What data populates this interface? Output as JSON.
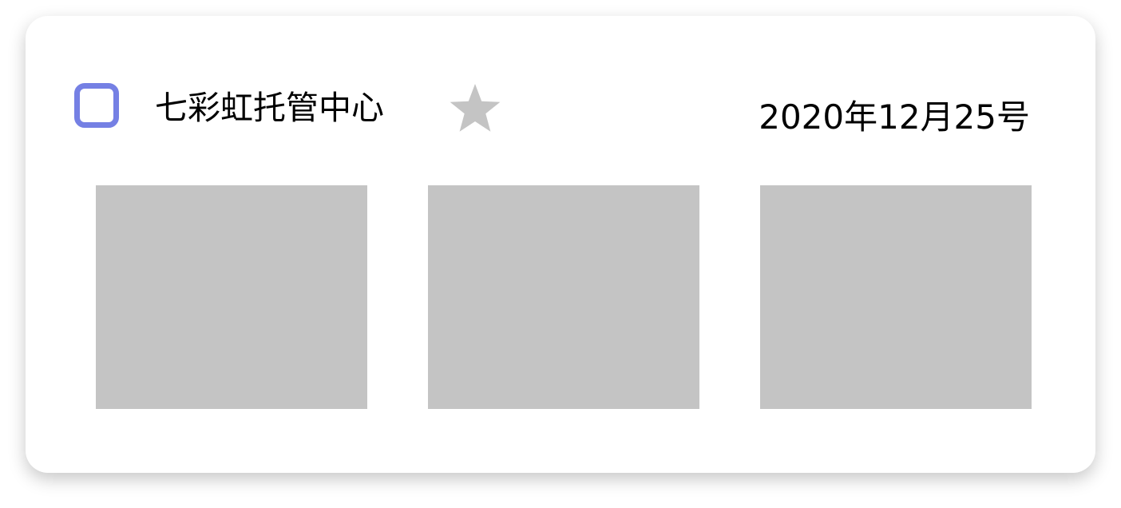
{
  "card": {
    "title": "七彩虹托管中心",
    "date": "2020年12月25号",
    "checkbox": {
      "checked": false
    },
    "favorite": {
      "icon": "star-icon",
      "starred": false
    },
    "images": [
      {
        "icon": "image-placeholder"
      },
      {
        "icon": "image-placeholder"
      },
      {
        "icon": "image-placeholder"
      }
    ]
  },
  "colors": {
    "checkbox_border": "#7580e4",
    "star": "#c4c4c4",
    "placeholder": "#c4c4c4",
    "text": "#000000"
  }
}
